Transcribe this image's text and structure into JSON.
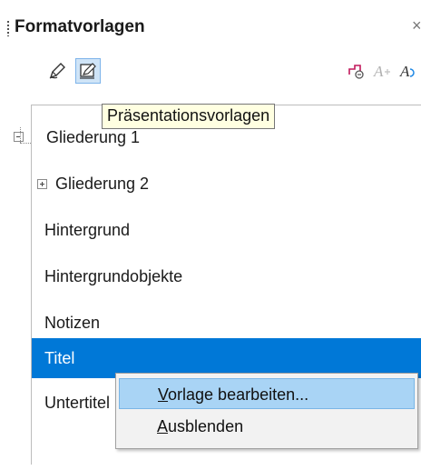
{
  "panel": {
    "title": "Formatvorlagen",
    "close_label": "×"
  },
  "toolbar": {
    "buttons": [
      {
        "icon": "drawing-styles-icon",
        "active": false
      },
      {
        "icon": "presentation-styles-icon",
        "active": true
      },
      {
        "icon": "fill-format-mode-icon",
        "active": false
      },
      {
        "icon": "new-style-from-selection-icon",
        "active": false
      },
      {
        "icon": "update-style-icon",
        "active": false
      }
    ]
  },
  "tooltip": {
    "text": "Präsentationsvorlagen"
  },
  "styles_list": {
    "items": [
      {
        "label": "Gliederung 1",
        "expander": "minus"
      },
      {
        "label": "Gliederung 2",
        "expander": "plus"
      },
      {
        "label": "Hintergrund"
      },
      {
        "label": "Hintergrundobjekte"
      },
      {
        "label": "Notizen"
      },
      {
        "label": "Titel",
        "selected": true
      },
      {
        "label": "Untertitel"
      }
    ]
  },
  "context_menu": {
    "items": [
      {
        "mnemonic": "V",
        "rest": "orlage bearbeiten...",
        "highlighted": true
      },
      {
        "mnemonic": "A",
        "rest": "usblenden"
      }
    ]
  },
  "colors": {
    "selection": "#0078d7",
    "menu_hover": "#a9d4f5",
    "tooltip_bg": "#ffffe1"
  }
}
